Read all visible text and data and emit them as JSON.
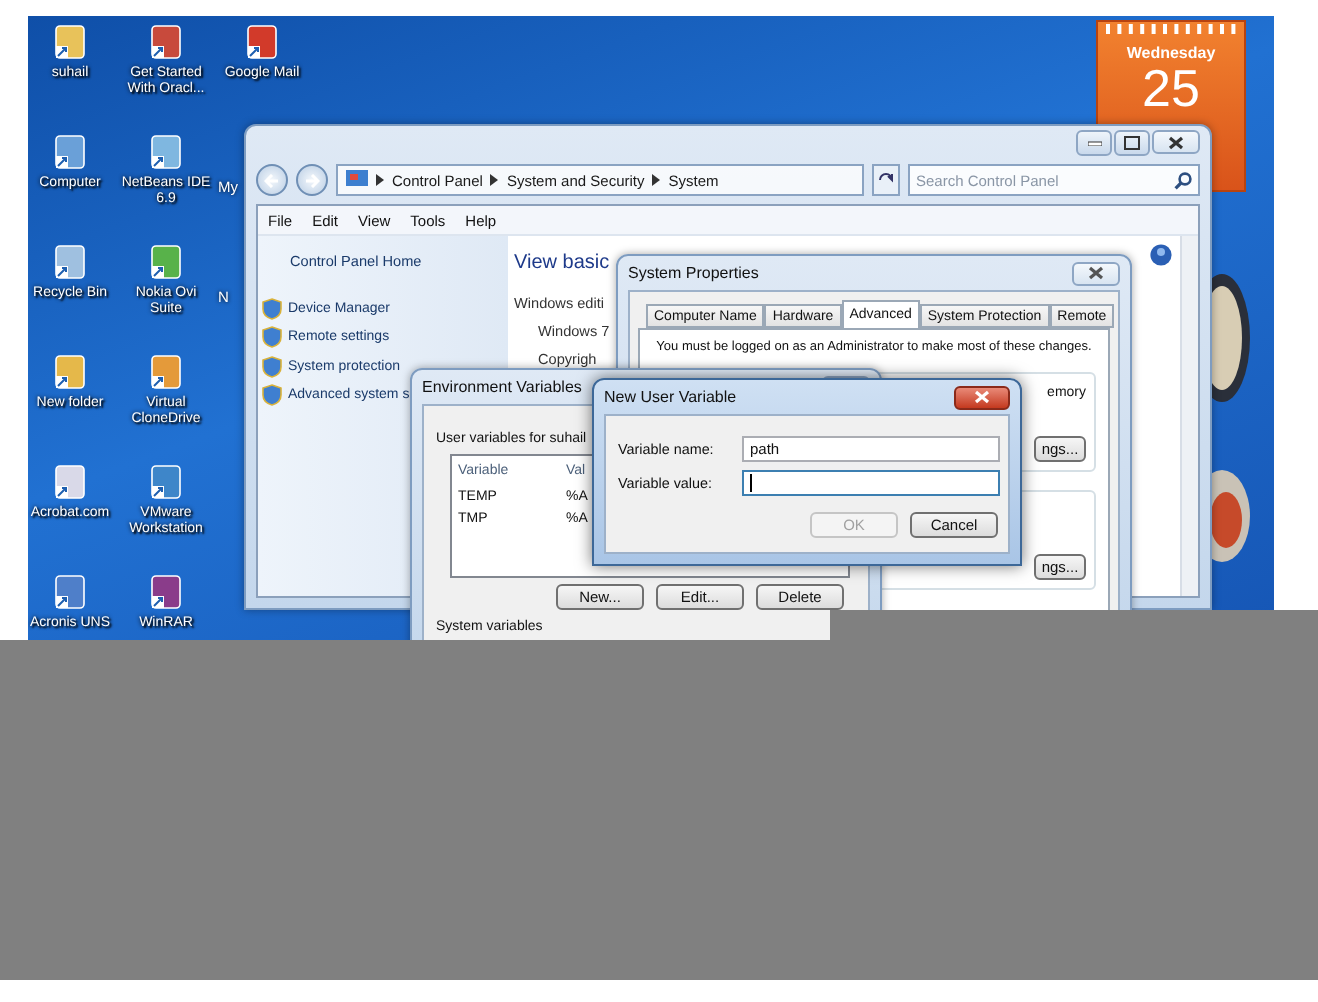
{
  "desktop": {
    "icon_columns": [
      [
        {
          "label": "suhail",
          "kind": "icon"
        },
        {
          "label": "Computer",
          "kind": "icon"
        },
        {
          "label": "Recycle Bin",
          "kind": "icon"
        },
        {
          "label": "New folder",
          "kind": "icon"
        },
        {
          "label": "Acrobat.com",
          "kind": "icon"
        },
        {
          "label": "Acronis UNS",
          "kind": "icon"
        }
      ],
      [
        {
          "label": "Get Started With Oracl...",
          "kind": "icon"
        },
        {
          "label": "NetBeans IDE 6.9",
          "kind": "icon"
        },
        {
          "label": "Nokia Ovi Suite",
          "kind": "icon"
        },
        {
          "label": "Virtual CloneDrive",
          "kind": "icon"
        },
        {
          "label": "VMware Workstation",
          "kind": "icon"
        },
        {
          "label": "WinRAR",
          "kind": "icon"
        }
      ],
      [
        {
          "label": "Google Mail",
          "kind": "icon"
        },
        {
          "label": "My",
          "kind": "partial"
        },
        {
          "label": "N",
          "kind": "partial"
        }
      ]
    ]
  },
  "calendar_gadget": {
    "weekday": "Wednesday",
    "day": "25"
  },
  "control_panel_window": {
    "breadcrumb": [
      "Control Panel",
      "System and Security",
      "System"
    ],
    "search": {
      "placeholder": "Search Control Panel"
    },
    "menu": [
      "File",
      "Edit",
      "View",
      "Tools",
      "Help"
    ],
    "sidebar": {
      "home": "Control Panel Home",
      "links": [
        "Device Manager",
        "Remote settings",
        "System protection",
        "Advanced system s"
      ]
    },
    "main": {
      "heading": "View basic",
      "sections": [
        {
          "label": "Windows editi",
          "children": [
            "Windows 7",
            "Copyrigh"
          ]
        }
      ]
    }
  },
  "system_properties": {
    "title": "System Properties",
    "tabs": [
      {
        "label": "Computer Name",
        "selected": false
      },
      {
        "label": "Hardware",
        "selected": false
      },
      {
        "label": "Advanced",
        "selected": true
      },
      {
        "label": "System Protection",
        "selected": false
      },
      {
        "label": "Remote",
        "selected": false
      }
    ],
    "notice": "You must be logged on as an Administrator to make most of these changes.",
    "groups": [
      {
        "text": "emory",
        "button": "ngs..."
      },
      {
        "button": "ngs..."
      }
    ]
  },
  "environment_variables": {
    "title": "Environment Variables",
    "user_section": "User variables for suhail",
    "columns": [
      "Variable",
      "Val"
    ],
    "rows": [
      {
        "variable": "TEMP",
        "value": "%A"
      },
      {
        "variable": "TMP",
        "value": "%A"
      }
    ],
    "buttons": [
      "New...",
      "Edit...",
      "Delete"
    ],
    "system_section": "System variables"
  },
  "new_user_variable": {
    "title": "New User Variable",
    "fields": [
      {
        "label": "Variable name:",
        "value": "path",
        "focused": false
      },
      {
        "label": "Variable value:",
        "focused": true
      }
    ],
    "buttons": [
      {
        "label": "OK",
        "disabled": true
      },
      {
        "label": "Cancel",
        "disabled": false
      }
    ]
  }
}
